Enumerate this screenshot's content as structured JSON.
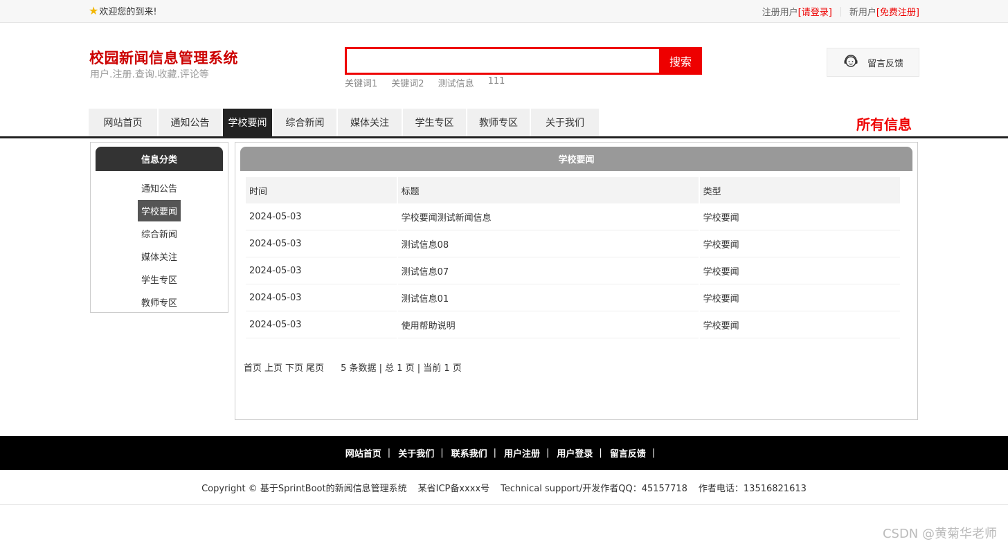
{
  "topbar": {
    "welcome": "欢迎您的到来!",
    "registered_label": "注册用户",
    "login_link": "[请登录]",
    "new_user_label": "新用户",
    "register_link": "[免费注册]"
  },
  "header": {
    "title": "校园新闻信息管理系统",
    "subtitle": "用户.注册.查询.收藏.评论等",
    "search_button": "搜索",
    "search_value": "",
    "hot_keywords": [
      "关键词1",
      "关键词2",
      "测试信息",
      "111"
    ],
    "feedback_label": "留言反馈"
  },
  "nav": {
    "items": [
      "网站首页",
      "通知公告",
      "学校要闻",
      "综合新闻",
      "媒体关注",
      "学生专区",
      "教师专区",
      "关于我们"
    ],
    "active": 2,
    "all_info": "所有信息"
  },
  "sidebar": {
    "title": "信息分类",
    "items": [
      "通知公告",
      "学校要闻",
      "综合新闻",
      "媒体关注",
      "学生专区",
      "教师专区"
    ],
    "active": 1
  },
  "main": {
    "title": "学校要闻",
    "columns": [
      "时间",
      "标题",
      "类型"
    ],
    "rows": [
      [
        "2024-05-03",
        "学校要闻测试新闻信息",
        "学校要闻"
      ],
      [
        "2024-05-03",
        "测试信息08",
        "学校要闻"
      ],
      [
        "2024-05-03",
        "测试信息07",
        "学校要闻"
      ],
      [
        "2024-05-03",
        "测试信息01",
        "学校要闻"
      ],
      [
        "2024-05-03",
        "使用帮助说明",
        "学校要闻"
      ]
    ],
    "pager": {
      "first": "首页",
      "prev": "上页",
      "next": "下页",
      "last": "尾页",
      "info": "5 条数据 | 总 1 页 | 当前 1 页"
    }
  },
  "footer": {
    "links": [
      "网站首页",
      "关于我们",
      "联系我们",
      "用户注册",
      "用户登录",
      "留言反馈"
    ],
    "copyright": "Copyright © 基于SprintBoot的新闻信息管理系统",
    "icp": "某省ICP备xxxx号",
    "support": "Technical support/开发作者QQ：45157718",
    "phone": "作者电话：13516821613"
  },
  "watermark": "CSDN @黄菊华老师",
  "colors": {
    "brand_red": "#e00000",
    "title_red": "#cc0000",
    "nav_active": "#222222",
    "panel_head_gray": "#999999"
  }
}
